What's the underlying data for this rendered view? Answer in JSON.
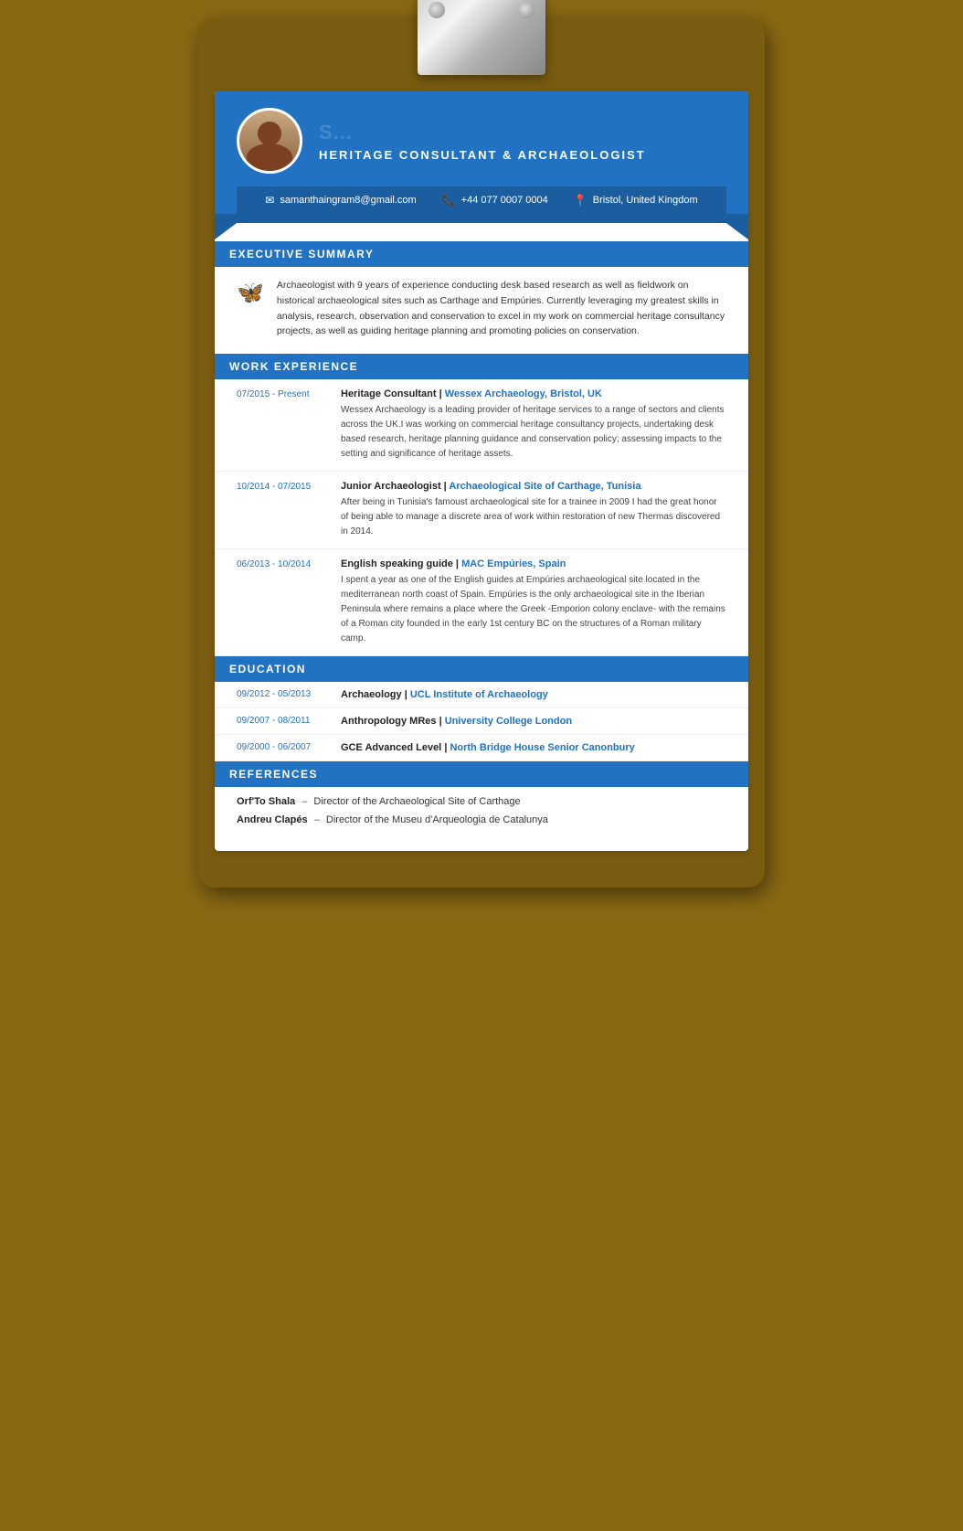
{
  "clipboard": {
    "clip_alt": "Clipboard metal clip"
  },
  "header": {
    "name": "S...",
    "title": "Heritage Consultant & Archaeologist",
    "contact": {
      "email": "samanthaingram8@gmail.com",
      "phone": "+44 077 0007 0004",
      "location": "Bristol, United Kingdom"
    }
  },
  "sections": {
    "executive_summary": {
      "label": "Executive Summary",
      "text": "Archaeologist with 9 years of experience conducting desk based research as well as fieldwork on historical archaeological sites such as Carthage and Empúries. Currently leveraging my greatest skills in analysis, research, observation and conservation to excel in my work on commercial heritage consultancy projects, as well as guiding heritage planning and promoting policies on conservation."
    },
    "work_experience": {
      "label": "Work Experience",
      "items": [
        {
          "date": "07/2015 - Present",
          "title": "Heritage Consultant",
          "separator": "|",
          "company": "Wessex Archaeology, Bristol, UK",
          "description": "Wessex Archaeology is a leading provider of heritage services to a range of sectors and clients across the UK.I was working on commercial heritage consultancy projects, undertaking desk based research, heritage planning guidance and conservation policy; assessing impacts to the setting and significance of heritage assets."
        },
        {
          "date": "10/2014 - 07/2015",
          "title": "Junior Archaeologist",
          "separator": "|",
          "company": "Archaeological Site of Carthage, Tunisia",
          "description": "After being in Tunisia's famoust archaeological site for a trainee in 2009 I had the great honor of being able to manage a discrete area of work within restoration of new Thermas discovered in 2014."
        },
        {
          "date": "06/2013 - 10/2014",
          "title": "English speaking guide",
          "separator": "|",
          "company": "MAC Empúries, Spain",
          "description": "I spent a year as one of the English guides at Empúries archaeological site located in the mediterranean north coast of Spain. Empúries is the only archaeological site in the Iberian Peninsula where remains a place where the Greek -Emporion colony enclave- with the remains of a Roman city founded in the early 1st century BC on the structures of a Roman military camp."
        }
      ]
    },
    "education": {
      "label": "Education",
      "items": [
        {
          "date": "09/2012 - 05/2013",
          "degree": "Archaeology",
          "separator": "|",
          "school": "UCL Institute of Archaeology"
        },
        {
          "date": "09/2007 - 08/2011",
          "degree": "Anthropology MRes",
          "separator": "|",
          "school": "University College London"
        },
        {
          "date": "09/2000 - 06/2007",
          "degree": "GCE Advanced Level",
          "separator": "|",
          "school": "North Bridge House Senior Canonbury"
        }
      ]
    },
    "references": {
      "label": "References",
      "items": [
        {
          "name": "Orf'To Shala",
          "dash": "–",
          "role": "Director of the Archaeological Site of Carthage"
        },
        {
          "name": "Andreu Clapés",
          "dash": "–",
          "role": "Director of the Museu d'Arqueologia de Catalunya"
        }
      ]
    }
  }
}
